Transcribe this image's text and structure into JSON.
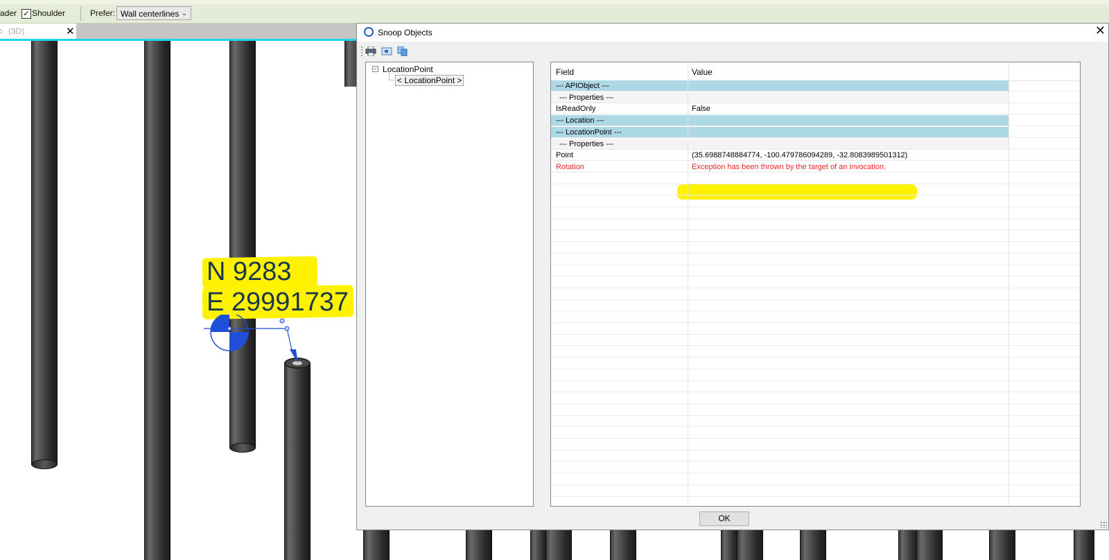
{
  "options_bar": {
    "leader_label": "ader",
    "shoulder_label": "Shoulder",
    "shoulder_checked": "✓",
    "prefer_label": "Prefer:",
    "prefer_value": "Wall centerlines"
  },
  "view_tab": {
    "label": "(3D)",
    "close": "✕"
  },
  "annotation": {
    "northing": "N 9283",
    "easting": "E 29991737"
  },
  "dialog": {
    "title": "Snoop Objects",
    "close": "✕",
    "tree": {
      "root": "LocationPoint",
      "toggle": "−",
      "child": "< LocationPoint >"
    },
    "grid": {
      "columns": [
        "Field",
        "Value"
      ],
      "rows": [
        {
          "field": "--- APIObject ---",
          "value": "",
          "kind": "sec"
        },
        {
          "field": "--- Properties ---",
          "value": "",
          "kind": "sub"
        },
        {
          "field": "IsReadOnly",
          "value": "False",
          "kind": "normal"
        },
        {
          "field": "--- Location ---",
          "value": "",
          "kind": "sec"
        },
        {
          "field": "--- LocationPoint ---",
          "value": "",
          "kind": "sec"
        },
        {
          "field": "--- Properties ---",
          "value": "",
          "kind": "sub"
        },
        {
          "field": "Point",
          "value": "(35.6988748884774, -100.479786094289, -32.8083989501312)",
          "kind": "normal"
        },
        {
          "field": "Rotation",
          "value": "Exception has been thrown by the target of an invocation.",
          "kind": "err"
        }
      ]
    },
    "ok_label": "OK"
  },
  "colors": {
    "highlight": "#fff200",
    "section_row": "#add8e6",
    "error_text": "#e8252a",
    "view_accent": "#1fd6e6"
  }
}
